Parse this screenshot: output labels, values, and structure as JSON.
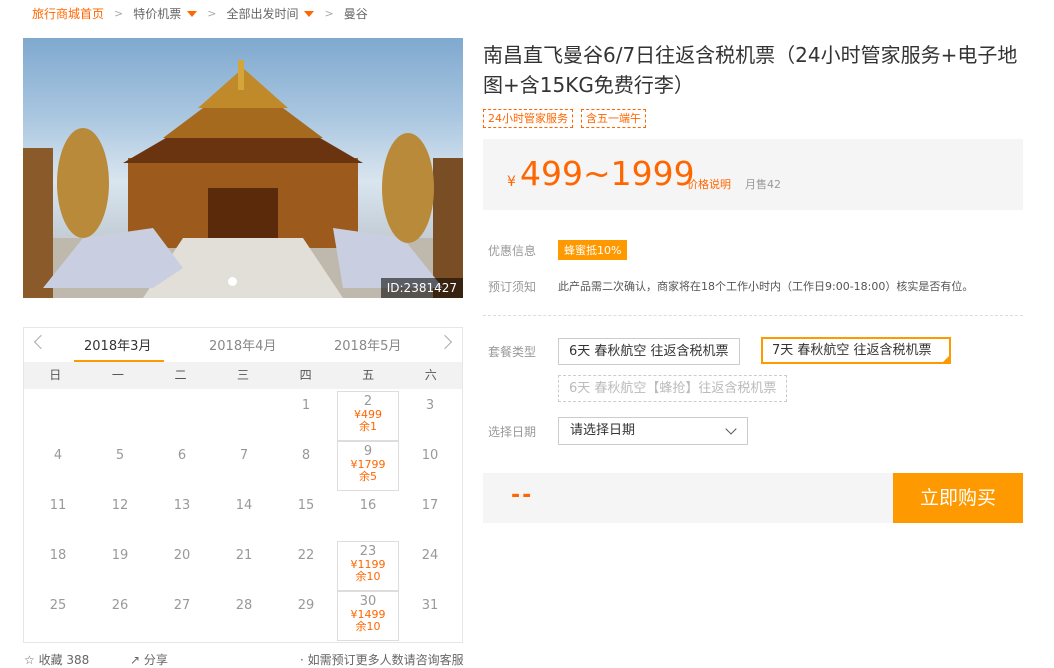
{
  "breadcrumb": {
    "home": "旅行商城首页",
    "item1": "特价机票",
    "item2": "全部出发时间",
    "item3": "曼谷"
  },
  "image": {
    "id": "ID:2381427"
  },
  "product": {
    "title": "南昌直飞曼谷6/7日往返含税机票（24小时管家服务+电子地图+含15KG免费行李）",
    "tags": [
      "24小时管家服务",
      "含五一端午"
    ],
    "price_symbol": "¥",
    "price": "499~1999",
    "price_explain": "价格说明",
    "monthly_sales": "月售42"
  },
  "info": {
    "promo_label": "优惠信息",
    "promo_badge": "蜂蜜抵10%",
    "notice_label": "预订须知",
    "notice_text": "此产品需二次确认，商家将在18个工作小时内（工作日9:00-18:00）核实是否有位。"
  },
  "options": {
    "package_label": "套餐类型",
    "packages": [
      "6天 春秋航空 往返含税机票",
      "7天 春秋航空 往返含税机票",
      "6天 春秋航空【蜂抢】往返含税机票"
    ],
    "date_label": "选择日期",
    "date_placeholder": "请选择日期"
  },
  "buy": {
    "total": "--",
    "button": "立即购买"
  },
  "calendar": {
    "months": [
      "2018年3月",
      "2018年4月",
      "2018年5月"
    ],
    "weekdays": [
      "日",
      "一",
      "二",
      "三",
      "四",
      "五",
      "六"
    ],
    "days": [
      "1",
      "2",
      "3",
      "4",
      "5",
      "6",
      "7",
      "8",
      "9",
      "10",
      "11",
      "12",
      "13",
      "14",
      "15",
      "16",
      "17",
      "18",
      "19",
      "20",
      "21",
      "22",
      "23",
      "24",
      "25",
      "26",
      "27",
      "28",
      "29",
      "30",
      "31"
    ],
    "available": {
      "2": {
        "price": "¥499",
        "stock": "余1"
      },
      "9": {
        "price": "¥1799",
        "stock": "余5"
      },
      "23": {
        "price": "¥1199",
        "stock": "余10"
      },
      "30": {
        "price": "¥1499",
        "stock": "余10"
      }
    }
  },
  "footer": {
    "fav": "收藏 388",
    "share": "分享",
    "note": "· 如需预订更多人数请咨询客服"
  },
  "colors": {
    "accent": "#ff9900",
    "price": "#ff6600"
  }
}
